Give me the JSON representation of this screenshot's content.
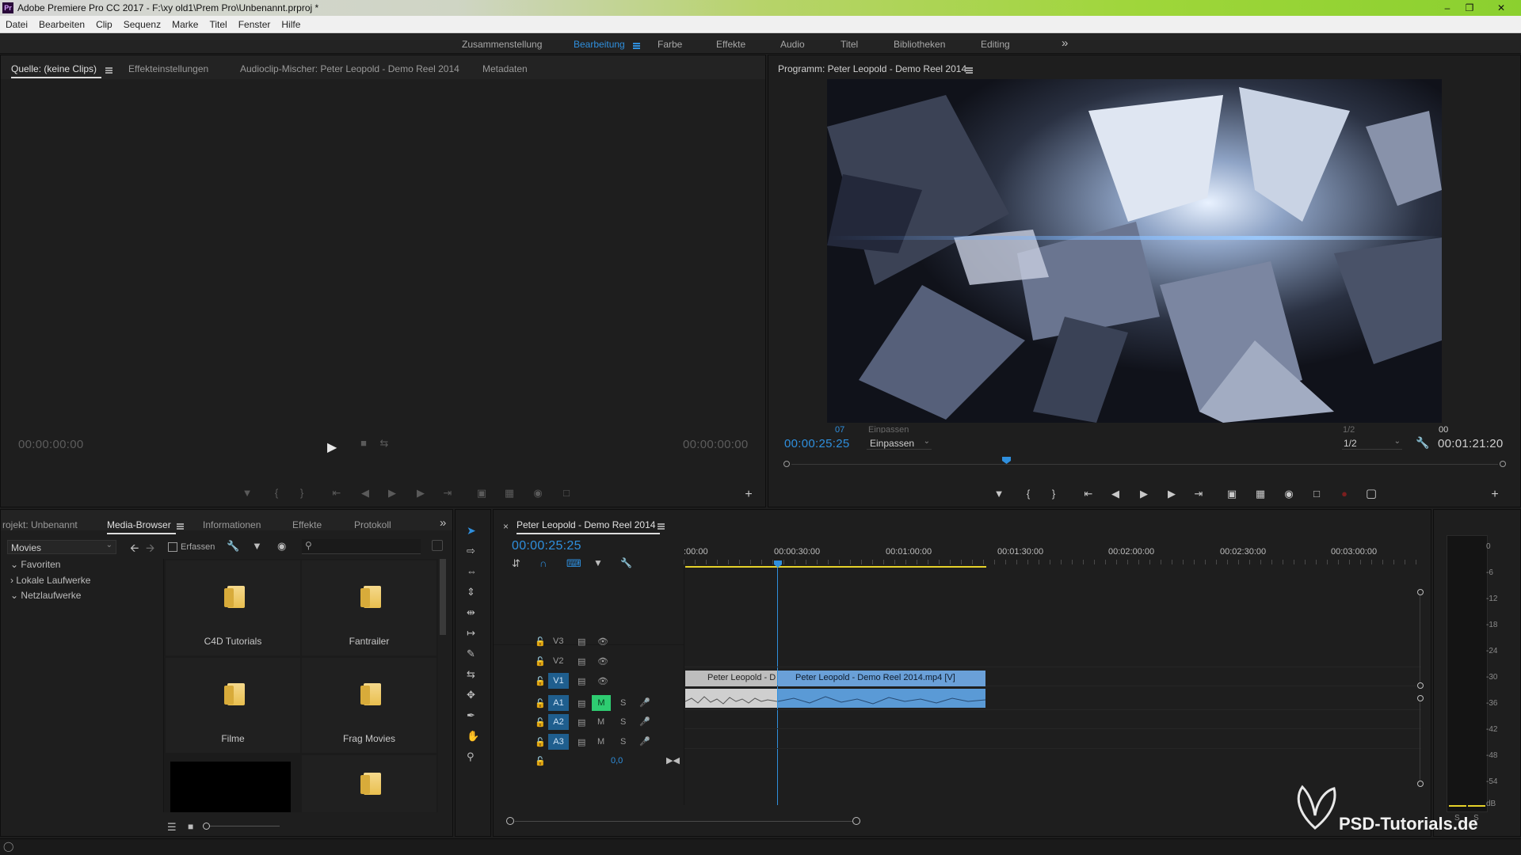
{
  "titlebar": {
    "icon": "Pr",
    "text": "Adobe Premiere Pro CC 2017 - F:\\xy old1\\Prem Pro\\Unbenannt.prproj *"
  },
  "menu": [
    "Datei",
    "Bearbeiten",
    "Clip",
    "Sequenz",
    "Marke",
    "Titel",
    "Fenster",
    "Hilfe"
  ],
  "workspaces": [
    "Zusammenstellung",
    "Bearbeitung",
    "Farbe",
    "Effekte",
    "Audio",
    "Titel",
    "Bibliotheken",
    "Editing"
  ],
  "workspace_overflow": "»",
  "source_panel": {
    "tabs": [
      "Quelle: (keine Clips)",
      "Effekteinstellungen",
      "Audioclip-Mischer: Peter Leopold - Demo Reel 2014",
      "Metadaten"
    ],
    "tc_left": "00:00:00:00",
    "tc_right": "00:00:00:00"
  },
  "program_panel": {
    "title": "Programm: Peter Leopold - Demo Reel 2014",
    "tc_current": "00:00:25:25",
    "fit": "Einpassen",
    "fit_ghost": "Einpassen",
    "ghost_tc": "07",
    "resolution": "1/2",
    "resolution_ghost": "1/2",
    "ghost_dur": "00",
    "tc_duration": "00:01:21:20"
  },
  "project_panel": {
    "tabs": [
      "rojekt: Unbenannt",
      "Media-Browser",
      "Informationen",
      "Effekte",
      "Protokoll"
    ],
    "location": "Movies",
    "ingest_label": "Erfassen",
    "tree": [
      "Favoriten",
      "Lokale Laufwerke",
      "Netzlaufwerke"
    ],
    "tiles": [
      "C4D Tutorials",
      "Fantrailer",
      "Filme",
      "Frag Movies"
    ]
  },
  "timeline": {
    "close": "×",
    "sequence_name": "Peter Leopold - Demo Reel 2014",
    "tc": "00:00:25:25",
    "ruler": [
      ":00:00",
      "00:00:30:00",
      "00:01:00:00",
      "00:01:30:00",
      "00:02:00:00",
      "00:02:30:00",
      "00:03:00:00"
    ],
    "video_tracks": [
      "V3",
      "V2",
      "V1"
    ],
    "audio_tracks": [
      "A1",
      "A2",
      "A3"
    ],
    "mute": "M",
    "solo": "S",
    "master_value": "0,0",
    "clip_v1_a": "Peter Leopold - D",
    "clip_v1_b": "Peter Leopold - Demo Reel 2014.mp4 [V]"
  },
  "audio_meter": {
    "scale": [
      "0",
      "-6",
      "-12",
      "-18",
      "-24",
      "-30",
      "-36",
      "-42",
      "-48",
      "-54",
      "dB"
    ],
    "solo_labels": [
      "S",
      "S"
    ]
  },
  "watermark": "PSD-Tutorials.de",
  "colors": {
    "accent": "#2f8fdd",
    "playhead": "#2f8fdd",
    "clip_video": "#6aa0d8",
    "clip_audio": "#5a9ad6",
    "mute_on": "#2ecc71",
    "work_area": "#e6d22a"
  }
}
